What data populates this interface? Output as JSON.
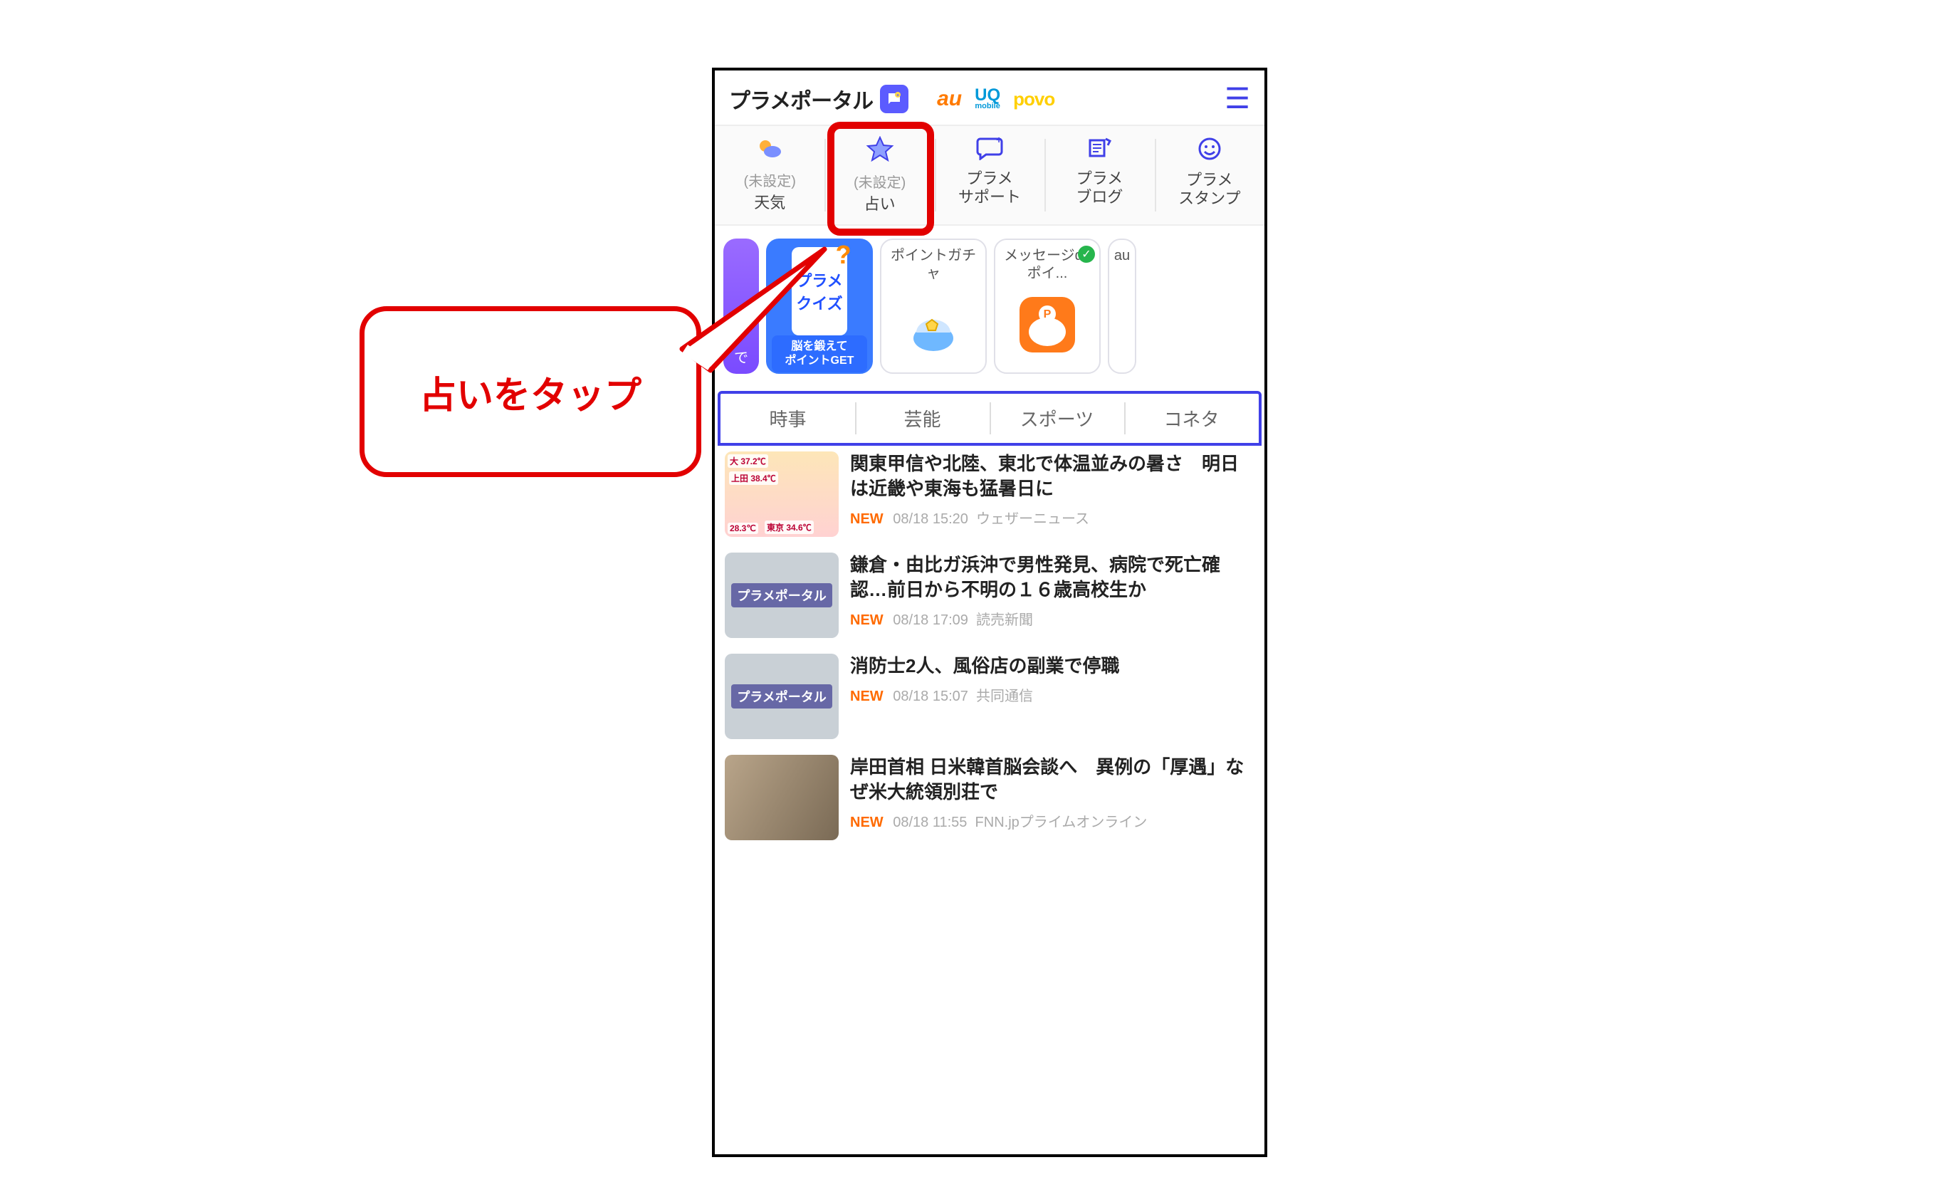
{
  "header": {
    "title": "プラメポータル",
    "brands": {
      "au": "au",
      "uq": "UQ",
      "uq_sub": "mobile",
      "povo": "povo"
    }
  },
  "nav": [
    {
      "sub": "(未設定)",
      "label": "天気"
    },
    {
      "sub": "(未設定)",
      "label": "占い"
    },
    {
      "label": "プラメ\nサポート"
    },
    {
      "label": "プラメ\nブログ"
    },
    {
      "label": "プラメ\nスタンプ"
    }
  ],
  "promo": {
    "purple_suffix": "で",
    "quiz_top": "プラメ\nクイズ",
    "quiz_bottom": "脳を鍛えて\nポイントGET",
    "gacha": "ポイントガチャ",
    "msg": "メッセージdeポイ...",
    "last": "au"
  },
  "tabs": [
    "時事",
    "芸能",
    "スポーツ",
    "コネタ"
  ],
  "news": [
    {
      "title": "関東甲信や北陸、東北で体温並みの暑さ　明日は近畿や東海も猛暑日に",
      "new": "NEW",
      "time": "08/18 15:20",
      "source": "ウェザーニュース",
      "thumb_kind": "map",
      "map_labels": [
        "大 37.2℃",
        "上田 38.4℃",
        "28.3℃",
        "東京 34.6℃"
      ]
    },
    {
      "title": "鎌倉・由比ガ浜沖で男性発見、病院で死亡確認…前日から不明の１６歳高校生か",
      "new": "NEW",
      "time": "08/18 17:09",
      "source": "読売新聞",
      "thumb_kind": "city",
      "thumb_text": "プラメポータル"
    },
    {
      "title": "消防士2人、風俗店の副業で停職",
      "new": "NEW",
      "time": "08/18 15:07",
      "source": "共同通信",
      "thumb_kind": "city",
      "thumb_text": "プラメポータル"
    },
    {
      "title": "岸田首相 日米韓首脳会談へ　異例の「厚遇」なぜ米大統領別荘で",
      "new": "NEW",
      "time": "08/18 11:55",
      "source": "FNN.jpプライムオンライン",
      "thumb_kind": "photo"
    }
  ],
  "callout": "占いをタップ"
}
